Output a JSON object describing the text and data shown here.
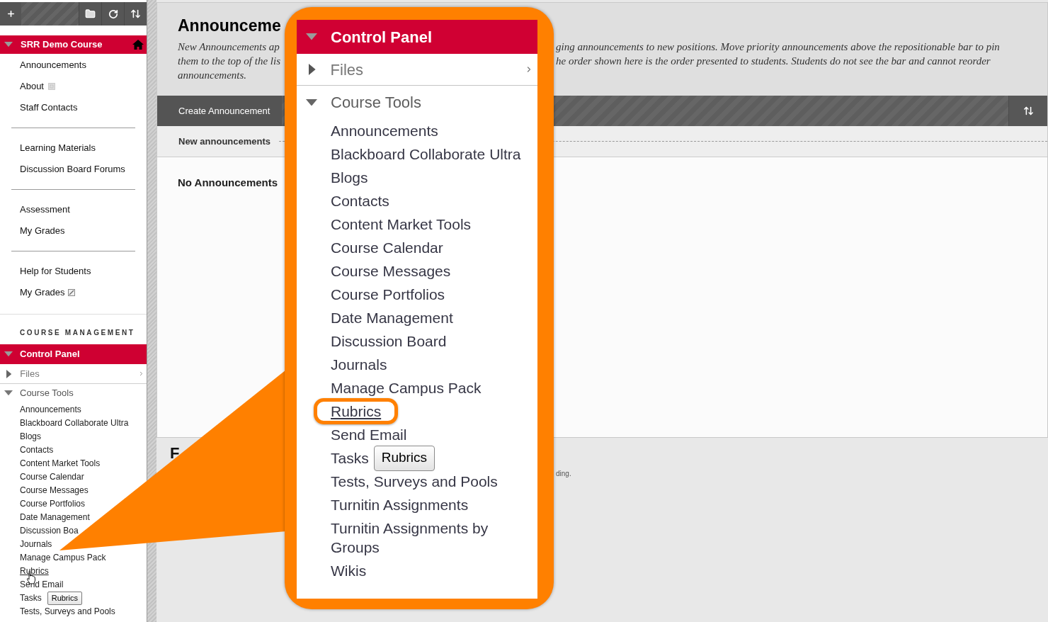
{
  "sidebar": {
    "course": {
      "title": "SRR Demo Course",
      "expanded": true
    },
    "menu_groups": [
      [
        {
          "label": "Announcements",
          "kind": "plain"
        },
        {
          "label": "About",
          "kind": "dotted"
        },
        {
          "label": "Staff Contacts",
          "kind": "plain"
        }
      ],
      [
        {
          "label": "Learning Materials",
          "kind": "plain"
        },
        {
          "label": "Discussion Board Forums",
          "kind": "plain"
        }
      ],
      [
        {
          "label": "Assessment",
          "kind": "plain"
        },
        {
          "label": "My Grades",
          "kind": "plain"
        }
      ],
      [
        {
          "label": "Help for Students",
          "kind": "plain"
        },
        {
          "label": "My Grades",
          "kind": "slashed"
        }
      ]
    ],
    "management_heading": "COURSE MANAGEMENT",
    "control_panel": {
      "title": "Control Panel",
      "expanded": true,
      "tooltip": "Rubrics",
      "sections": [
        {
          "label": "Files",
          "kind": "flyout",
          "expanded": false
        },
        {
          "label": "Course Tools",
          "kind": "folder",
          "expanded": true,
          "children": [
            {
              "label": "Announcements",
              "hovered": false
            },
            {
              "label": "Blackboard Collaborate Ultra",
              "hovered": false
            },
            {
              "label": "Blogs",
              "hovered": false
            },
            {
              "label": "Contacts",
              "hovered": false
            },
            {
              "label": "Content Market Tools",
              "hovered": false
            },
            {
              "label": "Course Calendar",
              "hovered": false
            },
            {
              "label": "Course Messages",
              "hovered": false
            },
            {
              "label": "Course Portfolios",
              "hovered": false
            },
            {
              "label": "Date Management",
              "hovered": false
            },
            {
              "label": "Discussion Boa",
              "hovered": false
            },
            {
              "label": "Journals",
              "hovered": false
            },
            {
              "label": "Manage Campus Pack",
              "hovered": false
            },
            {
              "label": "Rubrics",
              "hovered": true
            },
            {
              "label": "Send Email",
              "hovered": false
            },
            {
              "label": "Tasks",
              "hovered": false
            },
            {
              "label": "Tests, Surveys and Pools",
              "hovered": false
            }
          ]
        }
      ]
    }
  },
  "main": {
    "title": "Announceme",
    "description": {
      "left_lines": [
        "New Announcements ap",
        "them to the top of the lis",
        "announcements."
      ],
      "right_lines": [
        "ging announcements to new positions. Move priority announcements above the repositionable bar to pin",
        "he order shown here is the order presented to students. Students do not see the bar and cannot reorder"
      ]
    },
    "action_bar": {
      "button": "Create Announcement"
    },
    "list_divider": "New announcements",
    "empty_message": "No Announcements"
  },
  "footer": {
    "heading": "F",
    "note": "ding."
  },
  "callout": {
    "title": "Control Panel",
    "expanded": true,
    "tooltip": "Rubrics",
    "sections": [
      {
        "label": "Files",
        "kind": "flyout",
        "expanded": false
      },
      {
        "label": "Course Tools",
        "kind": "folder",
        "expanded": true,
        "children": [
          {
            "label": "Announcements",
            "hovered": false,
            "highlighted": false
          },
          {
            "label": "Blackboard Collaborate Ultra",
            "hovered": false,
            "highlighted": false
          },
          {
            "label": "Blogs",
            "hovered": false,
            "highlighted": false
          },
          {
            "label": "Contacts",
            "hovered": false,
            "highlighted": false
          },
          {
            "label": "Content Market Tools",
            "hovered": false,
            "highlighted": false
          },
          {
            "label": "Course Calendar",
            "hovered": false,
            "highlighted": false
          },
          {
            "label": "Course Messages",
            "hovered": false,
            "highlighted": false
          },
          {
            "label": "Course Portfolios",
            "hovered": false,
            "highlighted": false
          },
          {
            "label": "Date Management",
            "hovered": false,
            "highlighted": false
          },
          {
            "label": "Discussion Board",
            "hovered": false,
            "highlighted": false
          },
          {
            "label": "Journals",
            "hovered": false,
            "highlighted": false
          },
          {
            "label": "Manage Campus Pack",
            "hovered": false,
            "highlighted": false
          },
          {
            "label": "Rubrics",
            "hovered": true,
            "highlighted": true
          },
          {
            "label": "Send Email",
            "hovered": false,
            "highlighted": false
          },
          {
            "label": "Tasks",
            "hovered": false,
            "highlighted": false
          },
          {
            "label": "Tests, Surveys and Pools",
            "hovered": false,
            "highlighted": false
          },
          {
            "label": "Turnitin Assignments",
            "hovered": false,
            "highlighted": false
          },
          {
            "label": "Turnitin Assignments by Groups",
            "hovered": false,
            "highlighted": false
          },
          {
            "label": "Wikis",
            "hovered": false,
            "highlighted": false
          }
        ]
      }
    ]
  }
}
